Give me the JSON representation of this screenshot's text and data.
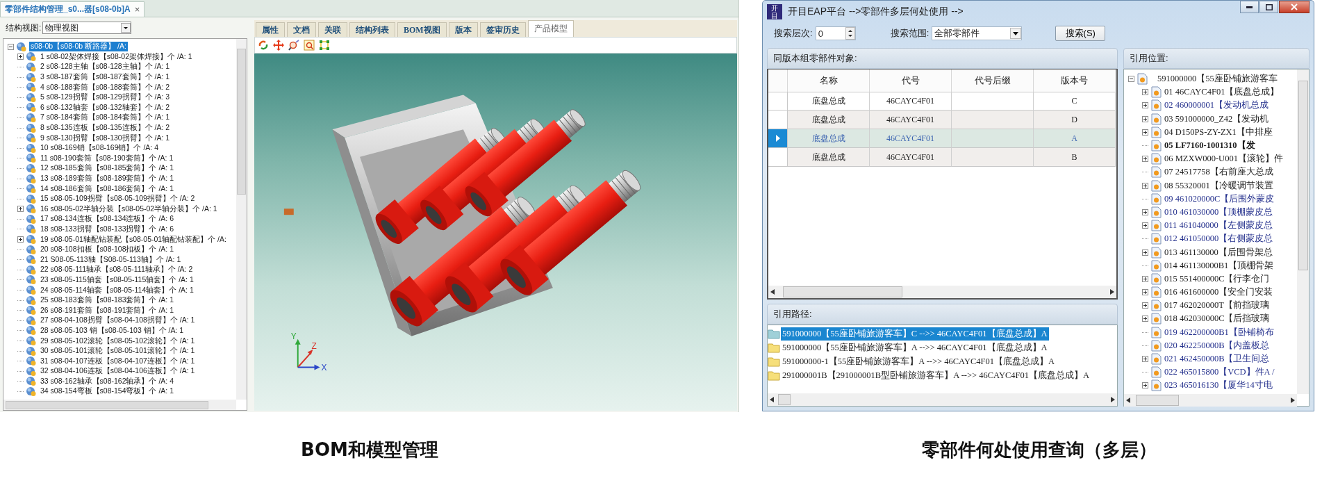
{
  "bom_window": {
    "document_tab": {
      "title": "零部件结构管理_s0...器[s08-0b]A",
      "close": "×"
    },
    "view_selector": {
      "label": "结构视图:",
      "value": "物理视图"
    },
    "structure_tree": {
      "label": "s08-0b【s08-0b 断路器】 /A:",
      "expanded": true,
      "selected": true,
      "children": [
        {
          "label": "1 s08-02架体焊接【s08-02架体焊接】个 /A: 1",
          "expandable": true
        },
        {
          "label": "2 s08-128主轴【s08-128主轴】个 /A: 1",
          "expandable": false
        },
        {
          "label": "3 s08-187套筒【s08-187套筒】个 /A: 1",
          "expandable": false
        },
        {
          "label": "4 s08-188套筒【s08-188套筒】个 /A: 2",
          "expandable": false
        },
        {
          "label": "5 s08-129拐臂【s08-129拐臂】个 /A: 3",
          "expandable": false
        },
        {
          "label": "6 s08-132轴套【s08-132轴套】个 /A: 2",
          "expandable": false
        },
        {
          "label": "7 s08-184套筒【s08-184套筒】个 /A: 1",
          "expandable": false
        },
        {
          "label": "8 s08-135连板【s08-135连板】个 /A: 2",
          "expandable": false
        },
        {
          "label": "9 s08-130拐臂【s08-130拐臂】个 /A: 1",
          "expandable": false
        },
        {
          "label": "10 s08-169销【s08-169销】个 /A: 4",
          "expandable": false
        },
        {
          "label": "11 s08-190套筒【s08-190套筒】个 /A: 1",
          "expandable": false
        },
        {
          "label": "12 s08-185套筒【s08-185套筒】个 /A: 1",
          "expandable": false
        },
        {
          "label": "13 s08-189套筒【s08-189套筒】个 /A: 1",
          "expandable": false
        },
        {
          "label": "14 s08-186套筒【s08-186套筒】个 /A: 1",
          "expandable": false
        },
        {
          "label": "15 s08-05-109拐臂【s08-05-109拐臂】个 /A: 2",
          "expandable": false
        },
        {
          "label": "16 s08-05-02半轴分装【s08-05-02半轴分装】个 /A: 1",
          "expandable": true
        },
        {
          "label": "17 s08-134连板【s08-134连板】个 /A: 6",
          "expandable": false
        },
        {
          "label": "18 s08-133拐臂【s08-133拐臂】个 /A: 6",
          "expandable": false
        },
        {
          "label": "19 s08-05-01轴配钻装配【s08-05-01轴配钻装配】个 /A:",
          "expandable": true
        },
        {
          "label": "20 s08-108扣板【s08-108扣板】个 /A: 1",
          "expandable": false
        },
        {
          "label": "21 S08-05-113轴【S08-05-113轴】个 /A: 1",
          "expandable": false
        },
        {
          "label": "22 s08-05-111轴承【s08-05-111轴承】个 /A: 2",
          "expandable": false
        },
        {
          "label": "23 s08-05-115轴套【s08-05-115轴套】个 /A: 1",
          "expandable": false
        },
        {
          "label": "24 s08-05-114轴套【s08-05-114轴套】个 /A: 1",
          "expandable": false
        },
        {
          "label": "25 s08-183套筒【s08-183套筒】个 /A: 1",
          "expandable": false
        },
        {
          "label": "26 s08-191套筒【s08-191套筒】个 /A: 1",
          "expandable": false
        },
        {
          "label": "27 s08-04-108拐臂【s08-04-108拐臂】个 /A: 1",
          "expandable": false
        },
        {
          "label": "28 s08-05-103 销【s08-05-103 销】个 /A: 1",
          "expandable": false
        },
        {
          "label": "29 s08-05-102滚轮【s08-05-102滚轮】个 /A: 1",
          "expandable": false
        },
        {
          "label": "30 s08-05-101滚轮【s08-05-101滚轮】个 /A: 1",
          "expandable": false
        },
        {
          "label": "31 s08-04-107连板【s08-04-107连板】个 /A: 1",
          "expandable": false
        },
        {
          "label": "32 s08-04-106连板【s08-04-106连板】个 /A: 1",
          "expandable": false
        },
        {
          "label": "33 s08-162轴承【s08-162轴承】个 /A: 4",
          "expandable": false
        },
        {
          "label": "34 s08-154弯板【s08-154弯板】个 /A: 1",
          "expandable": false
        }
      ]
    },
    "tabs": [
      {
        "label": "属性",
        "selected": false
      },
      {
        "label": "文档",
        "selected": false
      },
      {
        "label": "关联",
        "selected": false
      },
      {
        "label": "结构列表",
        "selected": false
      },
      {
        "label": "BOM视图",
        "selected": false
      },
      {
        "label": "版本",
        "selected": false
      },
      {
        "label": "签审历史",
        "selected": false
      },
      {
        "label": "产品模型",
        "selected": true
      }
    ],
    "viewport": {
      "axis_labels": [
        "Y",
        "Z",
        "X"
      ]
    }
  },
  "where_used_window": {
    "logo_text": "开目",
    "title": "开目EAP平台 -->零部件多层何处使用 -->",
    "search": {
      "level_label": "搜索层次:",
      "level_value": "0",
      "scope_label": "搜索范围:",
      "scope_value": "全部零部件",
      "button": "搜索(S)"
    },
    "parts_panel": {
      "title": "同版本组零部件对象:",
      "columns": [
        "名称",
        "代号",
        "代号后缀",
        "版本号"
      ],
      "rows": [
        {
          "name": "底盘总成",
          "code": "46CAYC4F01",
          "version": "C",
          "selected": false
        },
        {
          "name": "底盘总成",
          "code": "46CAYC4F01",
          "version": "D",
          "selected": false
        },
        {
          "name": "底盘总成",
          "code": "46CAYC4F01",
          "version": "A",
          "selected": true
        },
        {
          "name": "底盘总成",
          "code": "46CAYC4F01",
          "version": "B",
          "selected": false
        }
      ]
    },
    "path_panel": {
      "title": "引用路径:",
      "paths": [
        {
          "text": "591000000【55座卧铺旅游客车】C -->> 46CAYC4F01【底盘总成】A",
          "selected": true
        },
        {
          "text": "591000000【55座卧铺旅游客车】A -->> 46CAYC4F01【底盘总成】A",
          "selected": false
        },
        {
          "text": "591000000-1【55座卧铺旅游客车】A -->> 46CAYC4F01【底盘总成】A",
          "selected": false
        },
        {
          "text": "291000001B【291000001B型卧铺旅游客车】A -->> 46CAYC4F01【底盘总成】A",
          "selected": false
        }
      ]
    },
    "usage_panel": {
      "title": "引用位置:",
      "tree": {
        "label": "591000000【55座卧铺旅游客车",
        "expanded": true,
        "children": [
          {
            "label": "01 46CAYC4F01【底盘总成】",
            "expandable": true,
            "color": "#1c1c1c",
            "bold": false
          },
          {
            "label": "02 460000001【发动机总成",
            "expandable": true,
            "color": "#232f8c",
            "bold": false
          },
          {
            "label": "03 591000000_Z42【发动机",
            "expandable": true,
            "color": "#1c1c1c",
            "bold": false
          },
          {
            "label": "04 D150PS-ZY-ZX1【中排座",
            "expandable": true,
            "color": "#1c1c1c",
            "bold": false
          },
          {
            "label": "05 LF7160-1001310【发",
            "expandable": false,
            "color": "#1c1c1c",
            "bold": true
          },
          {
            "label": "06 MZXW000-U001【滚轮】件",
            "expandable": true,
            "color": "#1c1c1c",
            "bold": false
          },
          {
            "label": "07 24517758【右前座大总成",
            "expandable": false,
            "color": "#1c1c1c",
            "bold": false
          },
          {
            "label": "08 55320001【冷暖调节装置",
            "expandable": true,
            "color": "#1c1c1c",
            "bold": false
          },
          {
            "label": "09 461020000C【后围外蒙皮",
            "expandable": false,
            "color": "#232f8c",
            "bold": false
          },
          {
            "label": "010 461030000【顶棚蒙皮总",
            "expandable": true,
            "color": "#232f8c",
            "bold": false
          },
          {
            "label": "011 461040000【左侧蒙皮总",
            "expandable": true,
            "color": "#232f8c",
            "bold": false
          },
          {
            "label": "012 461050000【右侧蒙皮总",
            "expandable": false,
            "color": "#232f8c",
            "bold": false
          },
          {
            "label": "013 461130000【后围骨架总",
            "expandable": true,
            "color": "#1c1c1c",
            "bold": false
          },
          {
            "label": "014 461130000B1【顶棚骨架",
            "expandable": false,
            "color": "#1c1c1c",
            "bold": false
          },
          {
            "label": "015 551400000C【行李仓门",
            "expandable": true,
            "color": "#1c1c1c",
            "bold": false
          },
          {
            "label": "016 461600000【安全门安装",
            "expandable": true,
            "color": "#1c1c1c",
            "bold": false
          },
          {
            "label": "017 462020000T【前挡玻璃",
            "expandable": true,
            "color": "#1c1c1c",
            "bold": false
          },
          {
            "label": "018 462030000C【后挡玻璃",
            "expandable": true,
            "color": "#1c1c1c",
            "bold": false
          },
          {
            "label": "019 462200000B1【卧铺椅布",
            "expandable": false,
            "color": "#232f8c",
            "bold": false
          },
          {
            "label": "020 462250000B【内盖板总",
            "expandable": false,
            "color": "#232f8c",
            "bold": false
          },
          {
            "label": "021 462450000B【卫生间总",
            "expandable": true,
            "color": "#232f8c",
            "bold": false
          },
          {
            "label": "022 465015800【VCD】件A /",
            "expandable": false,
            "color": "#232f8c",
            "bold": false
          },
          {
            "label": "023 465016130【厦华14寸电",
            "expandable": true,
            "color": "#232f8c",
            "bold": false
          }
        ]
      }
    }
  },
  "captions": [
    "BOM和模型管理",
    "零部件何处使用查询（多层）"
  ]
}
